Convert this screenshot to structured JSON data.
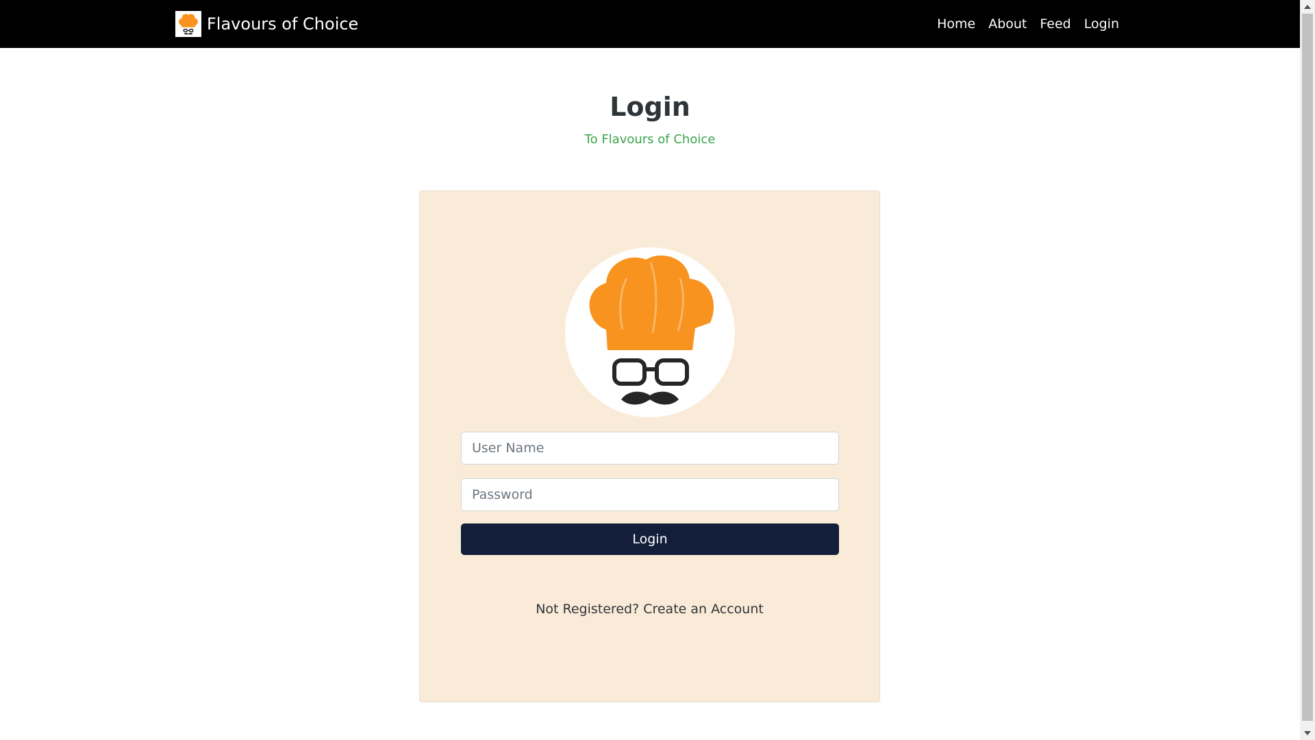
{
  "nav": {
    "brand": "Flavours of Choice",
    "links": [
      "Home",
      "About",
      "Feed",
      "Login"
    ]
  },
  "heading": {
    "title": "Login",
    "subtitle": "To Flavours of Choice"
  },
  "form": {
    "username_placeholder": "User Name",
    "username_value": "",
    "password_placeholder": "Password",
    "password_value": "",
    "submit_label": "Login",
    "register_text": "Not Registered? Create an Account"
  },
  "icons": {
    "brand": "chef-hat-logo-icon",
    "avatar": "chef-hat-glasses-mustache-icon"
  },
  "colors": {
    "navbar": "#000000",
    "card_background": "#faebd8",
    "button": "#121e3a",
    "subtitle": "#3aa34a",
    "hat_orange": "#f7931e"
  }
}
